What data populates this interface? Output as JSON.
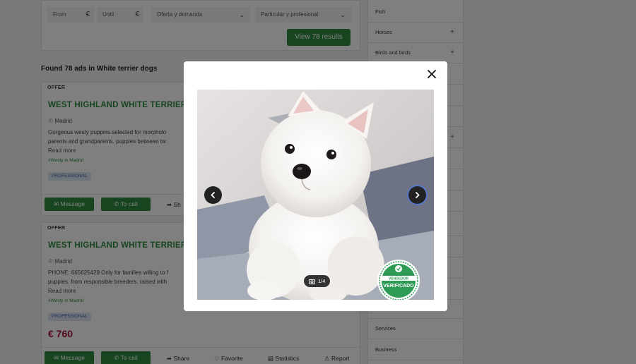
{
  "filters": {
    "from_label": "From",
    "until_label": "Until",
    "currency": "€",
    "offer_select": "Oferta y demanda",
    "seller_select": "Particular y profesional",
    "results_button": "View 78 results"
  },
  "results_heading": "Found 78 ads in White terrier dogs",
  "ads": [
    {
      "type": "OFFER",
      "title": "WEST HIGHLAND WHITE TERRIER",
      "location": "Madrid",
      "description": "Gorgeous westy puppies selected for morpholo parents and grandparents. puppies between tw",
      "read_more": "Read more",
      "tag": "#Westy in Madrid",
      "badge": "PROFESSIONAL",
      "actions": {
        "message": "Message",
        "call": "To call",
        "share": "Sh"
      }
    },
    {
      "type": "OFFER",
      "title": "WEST HIGHLAND WHITE TERRIER",
      "location": "Madrid",
      "description": "PHONE: 665625429 Only for families willing to f puppies. from responsible breeders. raised with",
      "read_more": "Read more",
      "tag": "#Westy in Madrid",
      "badge": "PROFESSIONAL",
      "price": "€ 760",
      "actions": {
        "message": "Message",
        "call": "To call",
        "share": "Share",
        "favorite": "Favorite",
        "statistics": "Statistics",
        "report": "Report"
      }
    }
  ],
  "sidebar": {
    "items": [
      {
        "label": "Fish",
        "expandable": false
      },
      {
        "label": "Horses",
        "expandable": true
      },
      {
        "label": "Birds and birds",
        "expandable": true
      },
      {
        "label": "Services",
        "expandable": false
      },
      {
        "label": "Business",
        "expandable": false
      }
    ]
  },
  "modal": {
    "counter": "1/4",
    "seal_top": "VENDEDOR",
    "seal_bottom": "VERIFICADO",
    "icons": {
      "close": "close-icon",
      "prev": "chevron-left-icon",
      "next": "chevron-right-icon",
      "camera": "camera-icon"
    }
  },
  "colors": {
    "brand_green": "#2e8b3e",
    "price_red": "#a4163b",
    "badge_blue": "#3d5fa8",
    "overlay": "rgba(0,0,0,0.5)"
  }
}
